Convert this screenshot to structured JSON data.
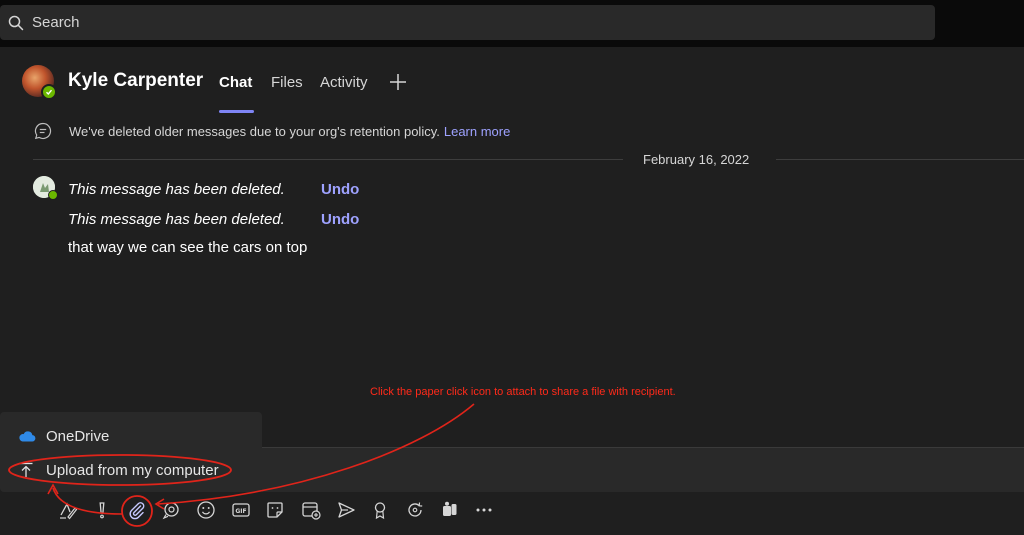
{
  "search": {
    "placeholder": "Search"
  },
  "header": {
    "contact_name": "Kyle Carpenter",
    "tabs": [
      {
        "label": "Chat",
        "active": true
      },
      {
        "label": "Files",
        "active": false
      },
      {
        "label": "Activity",
        "active": false
      }
    ]
  },
  "chat": {
    "retention_notice": "We've deleted older messages due to your org's retention policy.",
    "learn_more": "Learn more",
    "date_separator": "February 16, 2022",
    "messages": [
      {
        "text": "This message has been deleted.",
        "deleted": true,
        "action": "Undo"
      },
      {
        "text": "This message has been deleted.",
        "deleted": true,
        "action": "Undo"
      },
      {
        "text": "that way we can see the cars on top",
        "deleted": false
      }
    ]
  },
  "annotation": {
    "text": "Click the paper click icon to attach to share a file with recipient."
  },
  "attach_menu": {
    "items": [
      {
        "label": "OneDrive",
        "icon": "cloud-icon"
      },
      {
        "label": "Upload from my computer",
        "icon": "upload-icon"
      }
    ]
  },
  "compose_toolbar": {
    "icons": [
      "format-icon",
      "important-icon",
      "attach-icon",
      "loop-icon",
      "emoji-icon",
      "gif-icon",
      "sticker-icon",
      "schedule-meeting-icon",
      "send-icon",
      "praise-icon",
      "loop-component-icon",
      "apps-icon",
      "more-icon"
    ]
  },
  "colors": {
    "accent": "#7f85f5",
    "link": "#9ea2ff",
    "presence_available": "#6bb700",
    "annotation_red": "#ff2a1a"
  }
}
